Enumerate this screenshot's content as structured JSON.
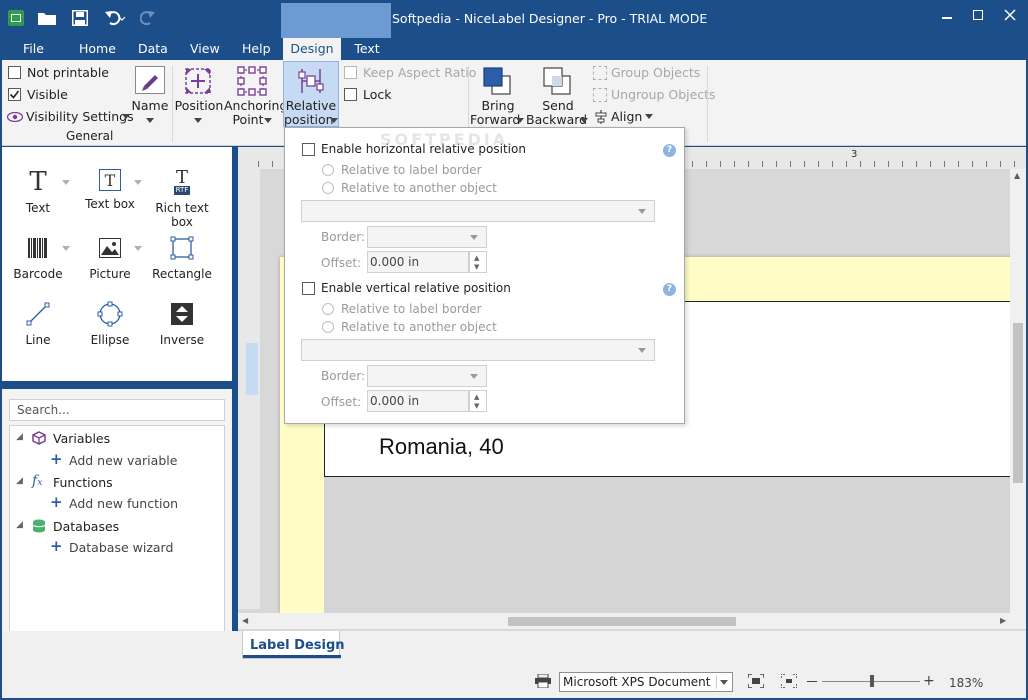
{
  "window": {
    "title": "Softpedia - NiceLabel Designer - Pro - TRIAL MODE"
  },
  "menu": {
    "file": "File",
    "home": "Home",
    "data": "Data",
    "view": "View",
    "help": "Help",
    "design": "Design",
    "text": "Text"
  },
  "ribbon": {
    "not_printable": "Not printable",
    "visible": "Visible",
    "visibility_settings": "Visibility Settings",
    "general": "General",
    "name": "Name",
    "position": "Position",
    "anchoring_1": "Anchoring",
    "anchoring_2": "Point",
    "relative_1": "Relative",
    "relative_2": "position",
    "keep_aspect": "Keep Aspect Ratio",
    "lock": "Lock",
    "bring_1": "Bring",
    "bring_2": "Forward",
    "send_1": "Send",
    "send_2": "Backward",
    "group": "Group Objects",
    "ungroup": "Ungroup Objects",
    "align": "Align"
  },
  "toolbox": {
    "text": "Text",
    "textbox": "Text box",
    "rtf_badge": "RTF",
    "richtext": "Rich text box",
    "barcode": "Barcode",
    "picture": "Picture",
    "rectangle": "Rectangle",
    "line": "Line",
    "ellipse": "Ellipse",
    "inverse": "Inverse"
  },
  "explorer": {
    "search_placeholder": "Search...",
    "variables": "Variables",
    "add_variable": "Add new variable",
    "functions": "Functions",
    "add_function": "Add new function",
    "databases": "Databases",
    "db_wizard": "Database wizard"
  },
  "popup": {
    "h_enable": "Enable horizontal relative position",
    "h_border": "Relative to label border",
    "h_object": "Relative to another object",
    "v_enable": "Enable vertical relative position",
    "v_border": "Relative to label border",
    "v_object": "Relative to another object",
    "border_label": "Border:",
    "offset_label": "Offset:",
    "h_offset": "0.000 in",
    "v_offset": "0.000 in"
  },
  "canvas": {
    "label_text": "Romania, 40",
    "ruler_3": "3"
  },
  "tab": {
    "label_design": "Label Design"
  },
  "status": {
    "printer": "Microsoft XPS Document Wr",
    "zoom": "183%"
  },
  "watermark": "SOFTPEDIA"
}
